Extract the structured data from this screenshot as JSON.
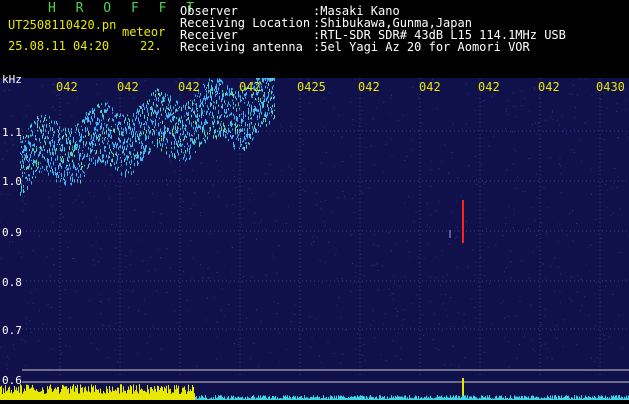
{
  "header": {
    "app_title": "H R O F F T",
    "filename": "UT2508110420.pn",
    "meteor_label": "meteor",
    "datetime": "25.08.11 04:20",
    "count": "22.",
    "observer_label": "Observer",
    "observer_value": ":Masaki Kano",
    "location_label": "Receiving Location",
    "location_value": ":Shibukawa,Gunma,Japan",
    "receiver_label": "Receiver",
    "receiver_value": ":RTL-SDR SDR# 43dB L15 114.1MHz USB",
    "antenna_label": "Receiving antenna",
    "antenna_value": ":5el Yagi Az 20 for Aomori VOR"
  },
  "axis": {
    "unit": "kHz",
    "y_ticks": [
      "1.1",
      "1.0",
      "0.9",
      "0.8",
      "0.7",
      "0.6"
    ],
    "x_ticks": [
      "042",
      "042",
      "042",
      "042",
      "0425",
      "042",
      "042",
      "042",
      "042",
      "0430"
    ]
  },
  "colors": {
    "background": "#10104a",
    "signal": "#3cb4ff",
    "yellow": "#e8e800",
    "cyan": "#39d8e8",
    "meteor_red": "#ff2020"
  }
}
